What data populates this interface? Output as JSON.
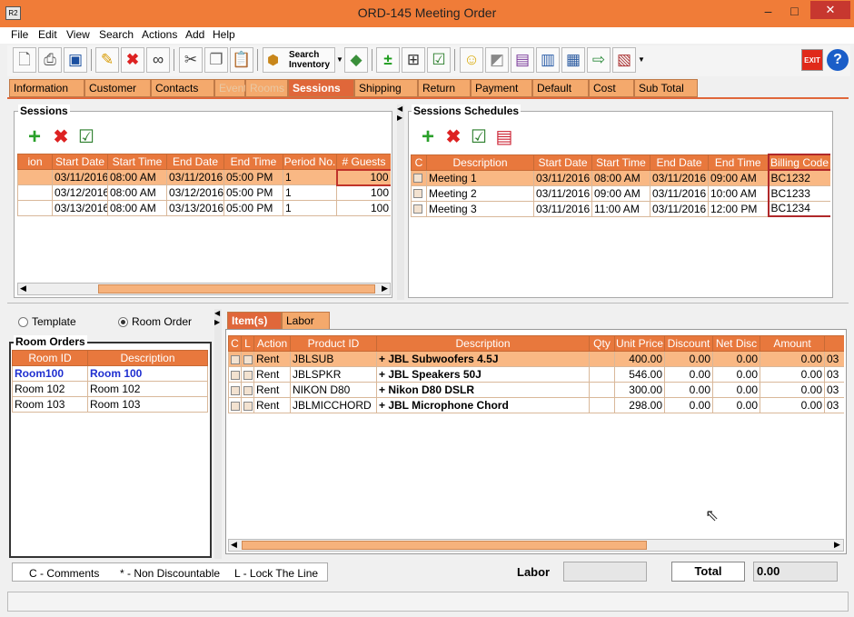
{
  "window": {
    "title": "ORD-145 Meeting Order",
    "app_icon": "R2",
    "minimize": "–",
    "maximize": "□",
    "close": "✕"
  },
  "menu": [
    "File",
    "Edit",
    "View",
    "Search",
    "Actions",
    "Add",
    "Help"
  ],
  "toolbar": {
    "search_inventory": "Search Inventory",
    "exit": "EXIT"
  },
  "tabs": [
    "Information",
    "Customer",
    "Contacts",
    "Event",
    "Rooms",
    "Sessions",
    "Shipping",
    "Return",
    "Payment",
    "Default",
    "Cost",
    "Sub Total"
  ],
  "sessions": {
    "label": "Sessions",
    "columns": [
      "ion",
      "Start Date",
      "Start Time",
      "End Date",
      "End Time",
      "Period No.",
      "# Guests"
    ],
    "rows": [
      [
        "",
        "03/11/2016",
        "08:00 AM",
        "03/11/2016",
        "05:00 PM",
        "1",
        "100"
      ],
      [
        "",
        "03/12/2016",
        "08:00 AM",
        "03/12/2016",
        "05:00 PM",
        "1",
        "100"
      ],
      [
        "",
        "03/13/2016",
        "08:00 AM",
        "03/13/2016",
        "05:00 PM",
        "1",
        "100"
      ]
    ]
  },
  "schedules": {
    "label": "Sessions Schedules",
    "columns": [
      "C",
      "Description",
      "Start Date",
      "Start Time",
      "End Date",
      "End Time",
      "Billing Code"
    ],
    "rows": [
      [
        "",
        "Meeting 1",
        "03/11/2016",
        "08:00 AM",
        "03/11/2016",
        "09:00 AM",
        "BC1232"
      ],
      [
        "",
        "Meeting 2",
        "03/11/2016",
        "09:00 AM",
        "03/11/2016",
        "10:00 AM",
        "BC1233"
      ],
      [
        "",
        "Meeting 3",
        "03/11/2016",
        "11:00 AM",
        "03/11/2016",
        "12:00 PM",
        "BC1234"
      ]
    ]
  },
  "mode": {
    "template": "Template",
    "room_order": "Room Order"
  },
  "room_orders": {
    "label": "Room Orders",
    "columns": [
      "Room ID",
      "Description"
    ],
    "rows": [
      [
        "Room100",
        "Room 100"
      ],
      [
        "Room 102",
        "Room 102"
      ],
      [
        "Room 103",
        "Room 103"
      ]
    ]
  },
  "item_tabs": [
    "Item(s)",
    "Labor"
  ],
  "items": {
    "columns": [
      "C",
      "L",
      "Action",
      "Product ID",
      "Description",
      "Qty",
      "Unit Price",
      "Discount",
      "Net Disc",
      "Amount"
    ],
    "rows": [
      [
        "",
        "",
        "Rent",
        "JBLSUB",
        "+ JBL Subwoofers 4.5J",
        "",
        "400.00",
        "0.00",
        "0.00",
        "0.00",
        "03"
      ],
      [
        "",
        "",
        "Rent",
        "JBLSPKR",
        "+ JBL Speakers 50J",
        "",
        "546.00",
        "0.00",
        "0.00",
        "0.00",
        "03"
      ],
      [
        "",
        "",
        "Rent",
        "NIKON D80",
        "+ Nikon D80 DSLR",
        "",
        "300.00",
        "0.00",
        "0.00",
        "0.00",
        "03"
      ],
      [
        "",
        "",
        "Rent",
        "JBLMICCHORD",
        "+ JBL Microphone Chord",
        "",
        "298.00",
        "0.00",
        "0.00",
        "0.00",
        "03"
      ]
    ]
  },
  "legend": {
    "comments": "C - Comments",
    "non_discount": "* - Non Discountable",
    "lock": "L - Lock The Line"
  },
  "footer": {
    "labor_label": "Labor",
    "labor_value": "",
    "total_label": "Total",
    "total_value": "0.00"
  },
  "colors": {
    "accent": "#e8783d",
    "title": "#f07c38",
    "highlight": "#f9b884"
  }
}
